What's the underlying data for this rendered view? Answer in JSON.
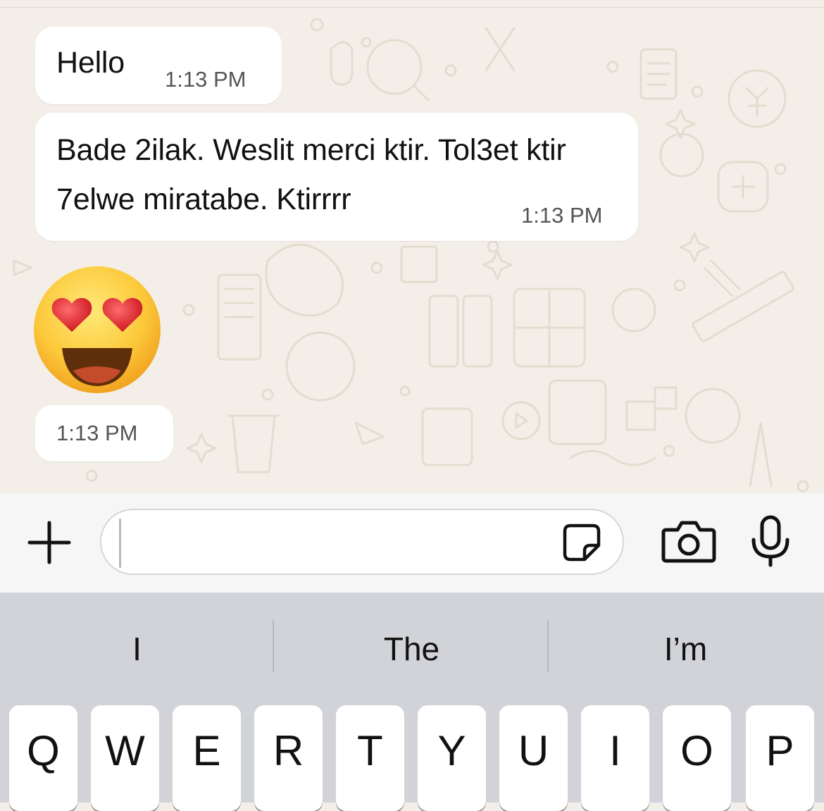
{
  "messages": [
    {
      "text": "Hello",
      "time": "1:13 PM"
    },
    {
      "text": "Bade 2ilak. Weslit merci ktir. Tol3et ktir 7elwe miratabe. Ktirrrr",
      "time": "1:13 PM"
    },
    {
      "emoji": "smiling-face-with-heart-eyes",
      "time": "1:13 PM"
    }
  ],
  "composer": {
    "placeholder": "",
    "icons": [
      "plus-icon",
      "sticker-icon",
      "camera-icon",
      "microphone-icon"
    ]
  },
  "keyboard": {
    "suggestions": [
      "I",
      "The",
      "I’m"
    ],
    "top_row": [
      "Q",
      "W",
      "E",
      "R",
      "T",
      "Y",
      "U",
      "I",
      "O",
      "P"
    ]
  },
  "colors": {
    "chat_background": "#f3efe8",
    "bubble": "#ffffff",
    "keyboard_background": "#d2d3d8"
  }
}
